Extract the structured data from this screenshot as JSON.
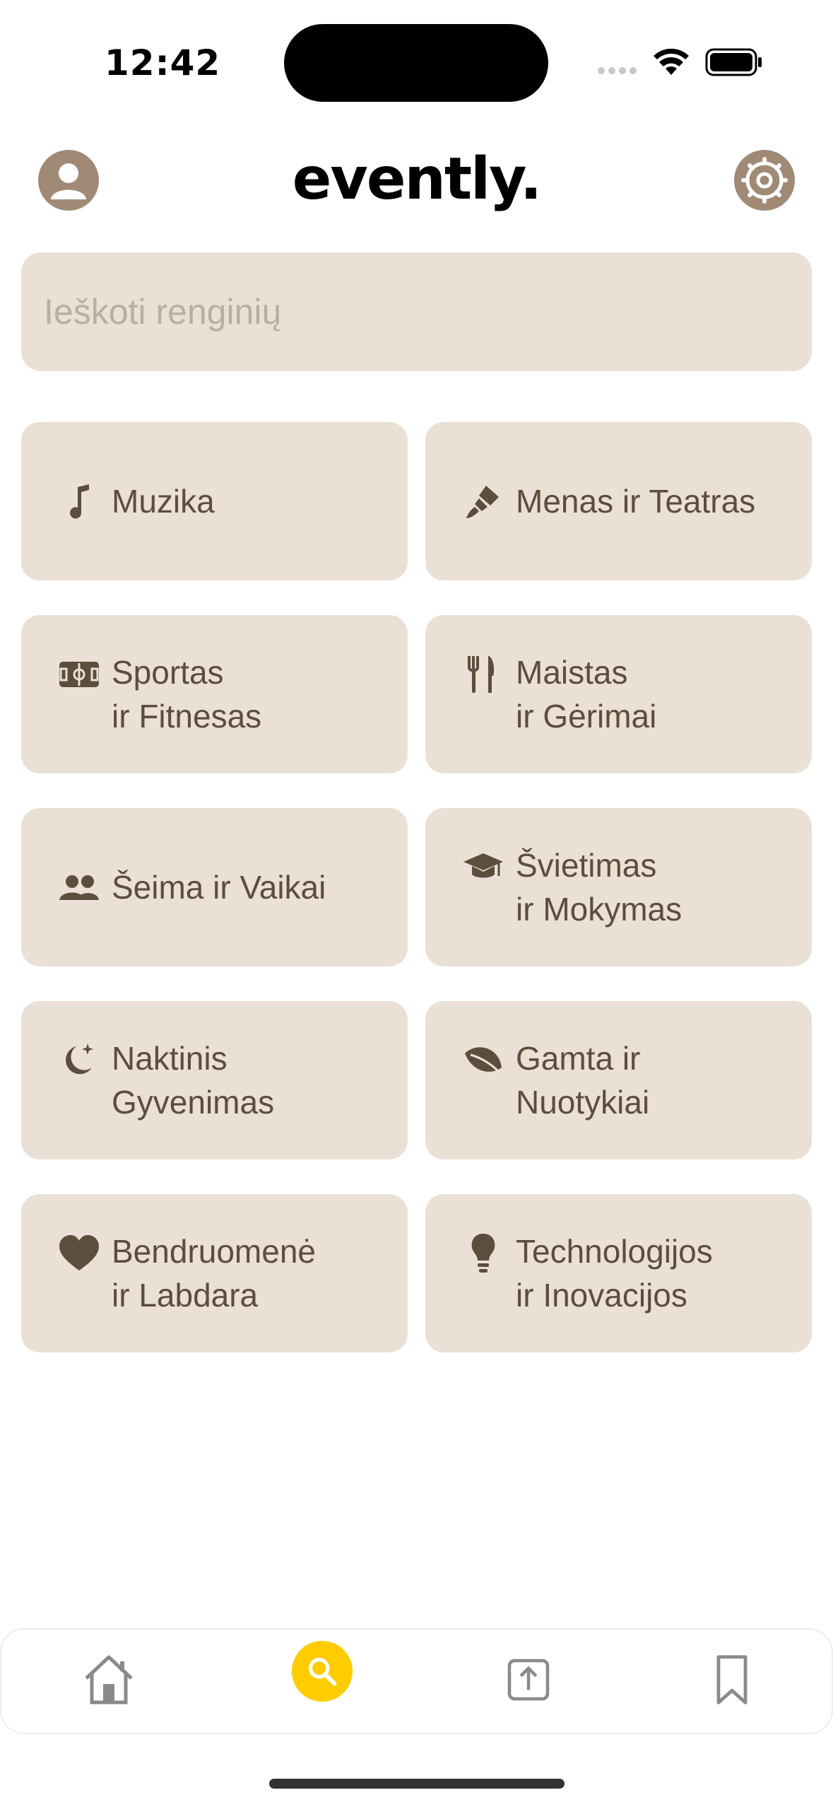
{
  "status_bar": {
    "time": "12:42"
  },
  "header": {
    "title": "evently."
  },
  "search": {
    "placeholder": "Ieškoti renginių",
    "value": ""
  },
  "categories": [
    {
      "label": "Muzika",
      "icon": "music-note-icon"
    },
    {
      "label": "Menas ir Teatras",
      "icon": "paintbrush-icon"
    },
    {
      "label": "Sportas\nir Fitnesas",
      "icon": "sports-field-icon"
    },
    {
      "label": "Maistas\nir Gėrimai",
      "icon": "fork-knife-icon"
    },
    {
      "label": "Šeima ir Vaikai",
      "icon": "people-icon"
    },
    {
      "label": "Švietimas\nir Mokymas",
      "icon": "graduation-cap-icon"
    },
    {
      "label": "Naktinis\nGyvenimas",
      "icon": "moon-stars-icon"
    },
    {
      "label": "Gamta ir\nNuotykiai",
      "icon": "leaf-icon"
    },
    {
      "label": "Bendruomenė\nir Labdara",
      "icon": "heart-icon"
    },
    {
      "label": "Technologijos\nir Inovacijos",
      "icon": "lightbulb-icon"
    }
  ],
  "tab_bar": {
    "items": [
      {
        "icon": "home-icon",
        "active": false
      },
      {
        "icon": "search-icon",
        "active": true
      },
      {
        "icon": "upload-icon",
        "active": false
      },
      {
        "icon": "bookmark-icon",
        "active": false
      }
    ]
  },
  "colors": {
    "card_bg": "#ebe0d5",
    "text_brown": "#5c4d3c",
    "avatar_bg": "#a08a76",
    "active_tab": "#ffcc00"
  }
}
